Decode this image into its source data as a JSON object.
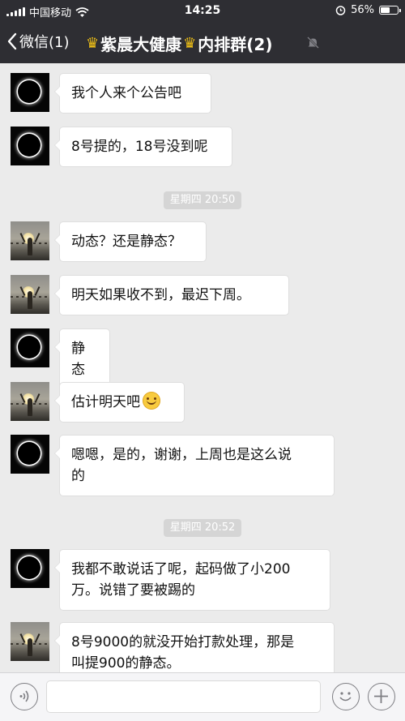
{
  "status_bar": {
    "carrier": "中国移动",
    "time": "14:25",
    "battery_percent": "56%",
    "battery_level": 0.56,
    "icons": [
      "signal-bars-icon",
      "wifi-icon",
      "alarm-clock-icon",
      "battery-icon"
    ]
  },
  "nav": {
    "back_label": "微信(1)",
    "title_part1": "紫晨大健康",
    "title_part2": "内排群(2)",
    "title_icons": [
      "crown-icon",
      "crown-icon"
    ],
    "muted_icon": "mute-bell-icon"
  },
  "messages": [
    {
      "type": "text",
      "avatar": "eclipse-avatar",
      "lines": [
        "我个人来个公告吧"
      ]
    },
    {
      "type": "text",
      "avatar": "eclipse-avatar",
      "lines": [
        "8号提的，18号没到呢"
      ]
    },
    {
      "type": "time",
      "text": "星期四 20:50"
    },
    {
      "type": "text",
      "avatar": "sunset-avatar",
      "lines": [
        "动态？还是静态？"
      ]
    },
    {
      "type": "text",
      "avatar": "sunset-avatar",
      "lines": [
        "明天如果收不到，最迟下周。"
      ]
    },
    {
      "type": "text",
      "avatar": "eclipse-avatar",
      "lines": [
        "静态"
      ]
    },
    {
      "type": "text",
      "avatar": "sunset-avatar",
      "lines": [
        "估计明天吧"
      ],
      "emoji": "smile-emoji-icon"
    },
    {
      "type": "text",
      "avatar": "eclipse-avatar",
      "lines": [
        "嗯嗯，是的，谢谢，上周也是这么说",
        "的"
      ]
    },
    {
      "type": "time",
      "text": "星期四 20:52"
    },
    {
      "type": "text",
      "avatar": "eclipse-avatar",
      "lines": [
        "我都不敢说话了呢，起码做了小200",
        "万。说错了要被踢的"
      ]
    },
    {
      "type": "text",
      "avatar": "sunset-avatar",
      "lines": [
        "8号9000的就没开始打款处理，那是",
        "叫提900的静态。"
      ]
    }
  ],
  "input_bar": {
    "voice_icon": "voice-icon",
    "emoji_icon": "emoji-icon",
    "plus_icon": "plus-icon",
    "text_value": ""
  },
  "colors": {
    "nav_bg": "#2e2e33",
    "chat_bg": "#ebebeb",
    "bubble_bg": "#ffffff",
    "crown": "#f3c316"
  }
}
